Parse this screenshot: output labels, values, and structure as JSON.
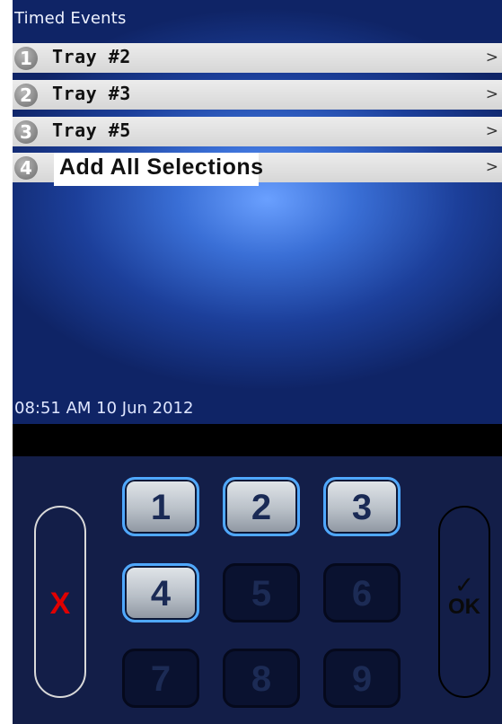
{
  "screen": {
    "title": "Timed Events",
    "menu_items": [
      {
        "number": "1",
        "label": "Tray #2",
        "arrow": ">"
      },
      {
        "number": "2",
        "label": "Tray #3",
        "arrow": ">"
      },
      {
        "number": "3",
        "label": "Tray #5",
        "arrow": ">"
      },
      {
        "number": "4",
        "label": "Add All Selections",
        "arrow": ">"
      }
    ],
    "datetime": "08:51 AM 10 Jun 2012"
  },
  "keypad": {
    "cancel_label": "X",
    "ok_check": "✓",
    "ok_label": "OK",
    "keys": [
      {
        "label": "1",
        "enabled": true
      },
      {
        "label": "2",
        "enabled": true
      },
      {
        "label": "3",
        "enabled": true
      },
      {
        "label": "4",
        "enabled": true
      },
      {
        "label": "5",
        "enabled": false
      },
      {
        "label": "6",
        "enabled": false
      },
      {
        "label": "7",
        "enabled": false
      },
      {
        "label": "8",
        "enabled": false
      },
      {
        "label": "9",
        "enabled": false
      }
    ]
  },
  "colors": {
    "screen_blue": "#1c3f9a",
    "keypad_bg": "#131e48",
    "key_highlight": "#4fa8ff",
    "cancel_red": "#e00000"
  }
}
